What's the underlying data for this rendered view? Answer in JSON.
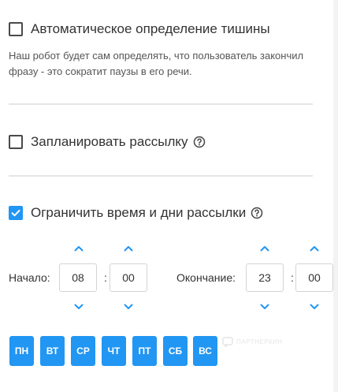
{
  "silence_detection": {
    "label": "Автоматическое определение тишины",
    "checked": false,
    "description": "Наш робот будет сам определять, что пользователь закончил фразу - это сократит паузы в его речи."
  },
  "schedule_mailing": {
    "label": "Запланировать рассылку",
    "checked": false,
    "help_icon": "question-circle-icon"
  },
  "limit_time": {
    "label": "Ограничить время и дни рассылки",
    "checked": true,
    "help_icon": "question-circle-icon"
  },
  "time": {
    "start_label": "Начало:",
    "start_hours": "08",
    "start_minutes": "00",
    "end_label": "Окончание:",
    "end_hours": "23",
    "end_minutes": "00",
    "separator": ":",
    "up_icon": "chevron-up-icon",
    "down_icon": "chevron-down-icon"
  },
  "days": [
    "ПН",
    "ВТ",
    "СР",
    "ЧТ",
    "ПТ",
    "СБ",
    "ВС"
  ],
  "watermark": "ПАРТНЕРКИН",
  "colors": {
    "accent": "#2196f3",
    "text": "#333333",
    "divider": "#e6e6e6"
  }
}
